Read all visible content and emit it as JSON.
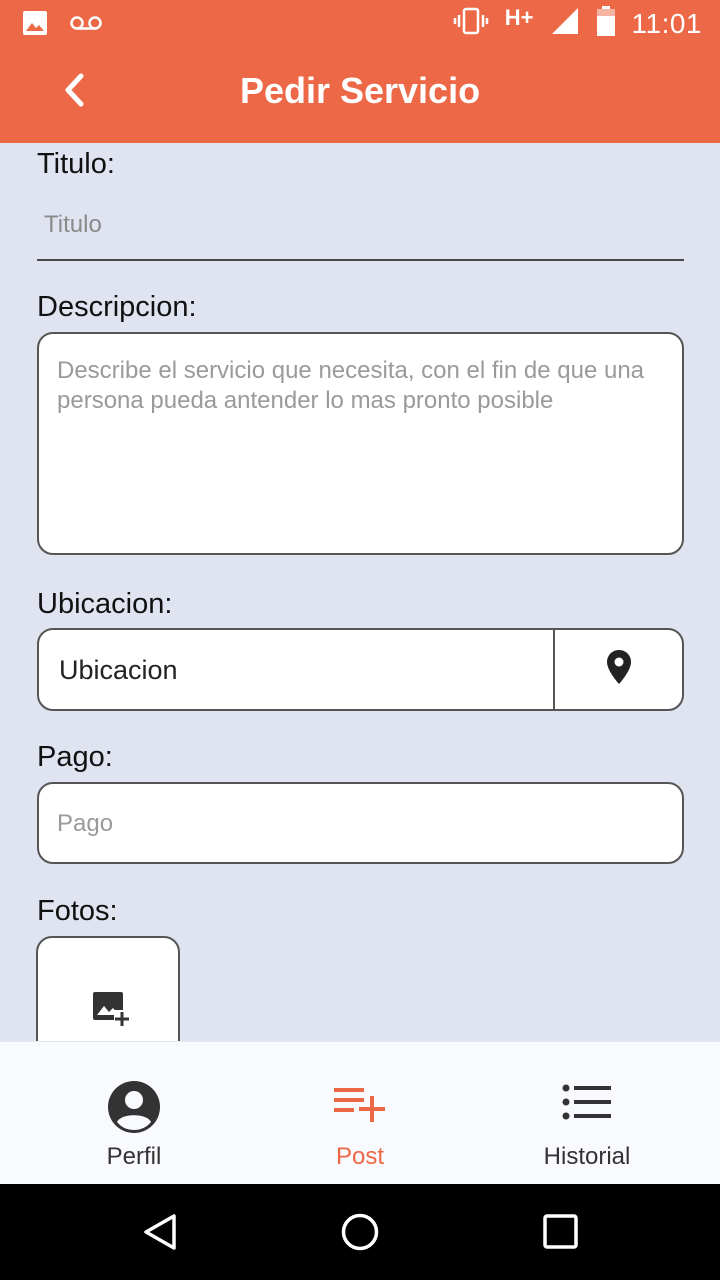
{
  "status_bar": {
    "time": "11:01",
    "network": "H+",
    "icons": [
      "image-icon",
      "voicemail-icon",
      "vibrate-icon",
      "signal-icon",
      "battery-icon"
    ]
  },
  "app_bar": {
    "title": "Pedir Servicio"
  },
  "form": {
    "titulo": {
      "label": "Titulo:",
      "placeholder": "Titulo"
    },
    "descripcion": {
      "label": "Descripcion:",
      "placeholder": "Describe el servicio que necesita, con el fin de que una persona pueda antender lo mas pronto posible"
    },
    "ubicacion": {
      "label": "Ubicacion:",
      "value": "Ubicacion"
    },
    "pago": {
      "label": "Pago:",
      "placeholder": "Pago"
    },
    "fotos": {
      "label": "Fotos:"
    }
  },
  "bottom_nav": {
    "items": [
      {
        "label": "Perfil",
        "icon": "account-circle-icon",
        "active": false
      },
      {
        "label": "Post",
        "icon": "playlist-add-icon",
        "active": true
      },
      {
        "label": "Historial",
        "icon": "list-icon",
        "active": false
      }
    ]
  },
  "colors": {
    "accent": "#ec6846",
    "background": "#dfe4f0",
    "nav_background": "#f9fafd"
  }
}
